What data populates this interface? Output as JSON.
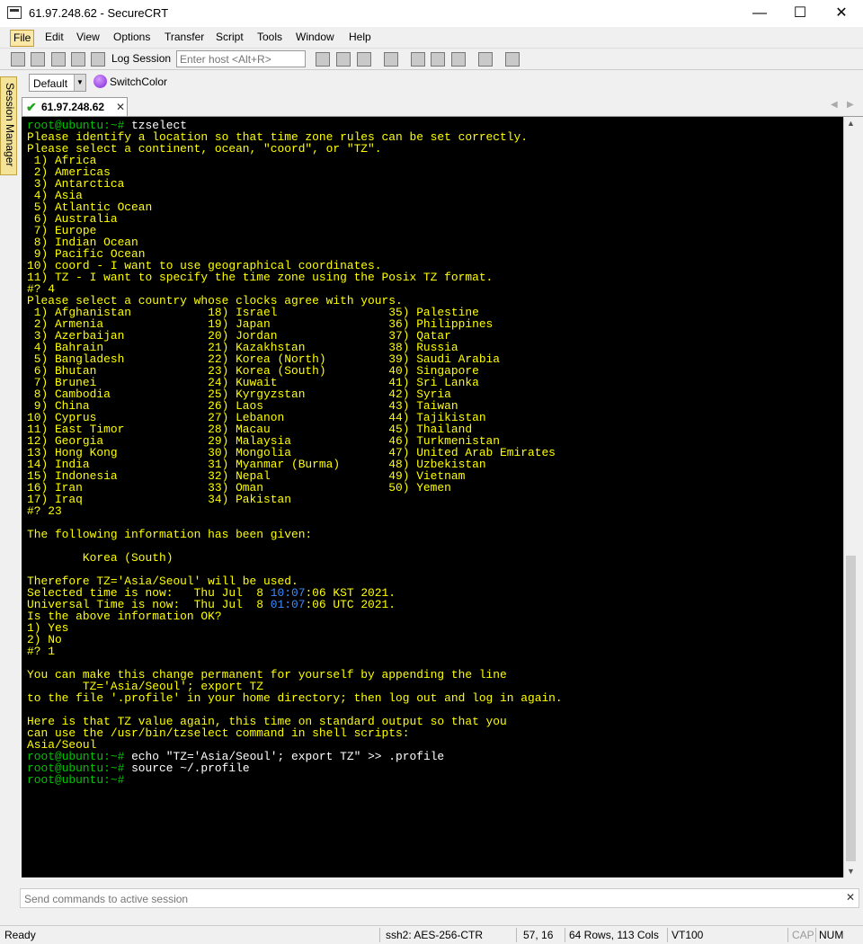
{
  "window": {
    "title": "61.97.248.62 - SecureCRT",
    "minimize": "—",
    "maximize": "☐",
    "close": "✕"
  },
  "menu": [
    "File",
    "Edit",
    "View",
    "Options",
    "Transfer",
    "Script",
    "Tools",
    "Window",
    "Help"
  ],
  "toolbar": {
    "log_session": "Log Session",
    "host_placeholder": "Enter host <Alt+R>"
  },
  "toolbar2": {
    "session_option": "Default",
    "switch_color": "SwitchColor"
  },
  "session_manager": "Session Manager",
  "tab": {
    "label": "61.97.248.62",
    "close": "✕"
  },
  "terminal": {
    "prompt_user": "root",
    "prompt_host": "@ubuntu",
    "prompt_path": ":~# ",
    "cmd1": "tzselect",
    "block1": "Please identify a location so that time zone rules can be set correctly.\nPlease select a continent, ocean, \"coord\", or \"TZ\".\n 1) Africa\n 2) Americas\n 3) Antarctica\n 4) Asia\n 5) Atlantic Ocean\n 6) Australia\n 7) Europe\n 8) Indian Ocean\n 9) Pacific Ocean\n10) coord - I want to use geographical coordinates.\n11) TZ - I want to specify the time zone using the Posix TZ format.\n#? 4\nPlease select a country whose clocks agree with yours.\n 1) Afghanistan           18) Israel                35) Palestine\n 2) Armenia               19) Japan                 36) Philippines\n 3) Azerbaijan            20) Jordan                37) Qatar\n 4) Bahrain               21) Kazakhstan            38) Russia\n 5) Bangladesh            22) Korea (North)         39) Saudi Arabia\n 6) Bhutan                23) Korea (South)         40) Singapore\n 7) Brunei                24) Kuwait                41) Sri Lanka\n 8) Cambodia              25) Kyrgyzstan            42) Syria\n 9) China                 26) Laos                  43) Taiwan\n10) Cyprus                27) Lebanon               44) Tajikistan\n11) East Timor            28) Macau                 45) Thailand\n12) Georgia               29) Malaysia              46) Turkmenistan\n13) Hong Kong             30) Mongolia              47) United Arab Emirates\n14) India                 31) Myanmar (Burma)       48) Uzbekistan\n15) Indonesia             32) Nepal                 49) Vietnam\n16) Iran                  33) Oman                  50) Yemen\n17) Iraq                  34) Pakistan\n#? 23\n\nThe following information has been given:\n\n        Korea (South)\n\nTherefore TZ='Asia/Seoul' will be used.",
    "sel_prefix": "Selected time is now:   Thu Jul  8 ",
    "sel_time": "10:07",
    "sel_suffix": ":06 KST 2021.",
    "uni_prefix": "Universal Time is now:  Thu Jul  8 ",
    "uni_time": "01:07",
    "uni_suffix": ":06 UTC 2021.",
    "block2": "Is the above information OK?\n1) Yes\n2) No\n#? 1\n\nYou can make this change permanent for yourself by appending the line\n        TZ='Asia/Seoul'; export TZ\nto the file '.profile' in your home directory; then log out and log in again.\n\nHere is that TZ value again, this time on standard output so that you\ncan use the /usr/bin/tzselect command in shell scripts:\nAsia/Seoul",
    "cmd2": "echo \"TZ='Asia/Seoul'; export TZ\" >> .profile",
    "cmd3": "source ~/.profile"
  },
  "command_bar": {
    "placeholder": "Send commands to active session",
    "close": "✕"
  },
  "status": {
    "ready": "Ready",
    "cipher": "ssh2: AES-256-CTR",
    "cursor": "57,  16",
    "size": "64 Rows, 113 Cols",
    "emulation": "VT100",
    "caps": "CAP",
    "num": "NUM"
  }
}
